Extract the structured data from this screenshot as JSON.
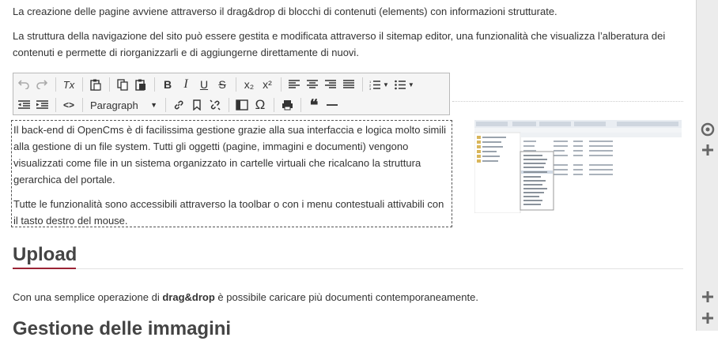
{
  "paragraphs": {
    "intro1": "La creazione delle pagine avviene attraverso il drag&drop di blocchi di contenuti (elements) con informazioni strutturate.",
    "intro2_l1": "La struttura della navigazione del sito può essere gestita e modificata attraverso il sitemap editor, una funzionalità che visualizza l’alberatura dei",
    "intro2_l2": "contenuti e permette di riorganizzarli e di aggiungerne direttamente di nuovi."
  },
  "toolbar": {
    "format_select": "Paragraph",
    "icons": [
      "undo-icon",
      "redo-icon",
      "clear-format-icon",
      "paste-icon",
      "copy-icon",
      "paste-text-icon",
      "bold-icon",
      "italic-icon",
      "underline-icon",
      "strikethrough-icon",
      "subscript-icon",
      "superscript-icon",
      "align-left-icon",
      "align-center-icon",
      "align-right-icon",
      "align-justify-icon",
      "numbered-list-icon",
      "bullet-list-icon",
      "outdent-icon",
      "indent-icon",
      "source-code-icon",
      "link-icon",
      "bookmark-icon",
      "unlink-icon",
      "template-icon",
      "special-char-icon",
      "print-icon",
      "blockquote-icon",
      "horizontal-rule-icon"
    ],
    "labels": {
      "bold": "B",
      "italic": "I",
      "underline": "U",
      "strike": "S",
      "sub": "x₂",
      "sup": "x²",
      "code": "<>",
      "omega": "Ω",
      "quote": "❝",
      "clear": "Tx"
    }
  },
  "editor": {
    "p1_l1": "Il back-end di OpenCms è di facilissima gestione grazie alla sua interfaccia e logica molto simili",
    "p1_l2": "alla gestione di un file system. Tutti gli oggetti (pagine, immagini e documenti) vengono",
    "p1_l3": "visualizzati come file in un sistema organizzato in cartelle virtuali che ricalcano la struttura",
    "p1_l4": "gerarchica del portale.",
    "p2_l1": "Tutte le funzionalità sono accessibili attraverso la toolbar o con i menu contestuali attivabili con",
    "p2_l2": "il tasto destro del mouse."
  },
  "upload": {
    "heading": "Upload",
    "text_before": "Con una semplice operazione di ",
    "text_bold": "drag&drop",
    "text_after": " è possibile caricare più documenti contemporaneamente."
  },
  "next_heading": "Gestione delle immagini",
  "colors": {
    "accent": "#9b2335",
    "gutter": "#ececec"
  },
  "gutter_icons": [
    "target-icon",
    "plus-icon",
    "plus-icon",
    "plus-icon"
  ]
}
